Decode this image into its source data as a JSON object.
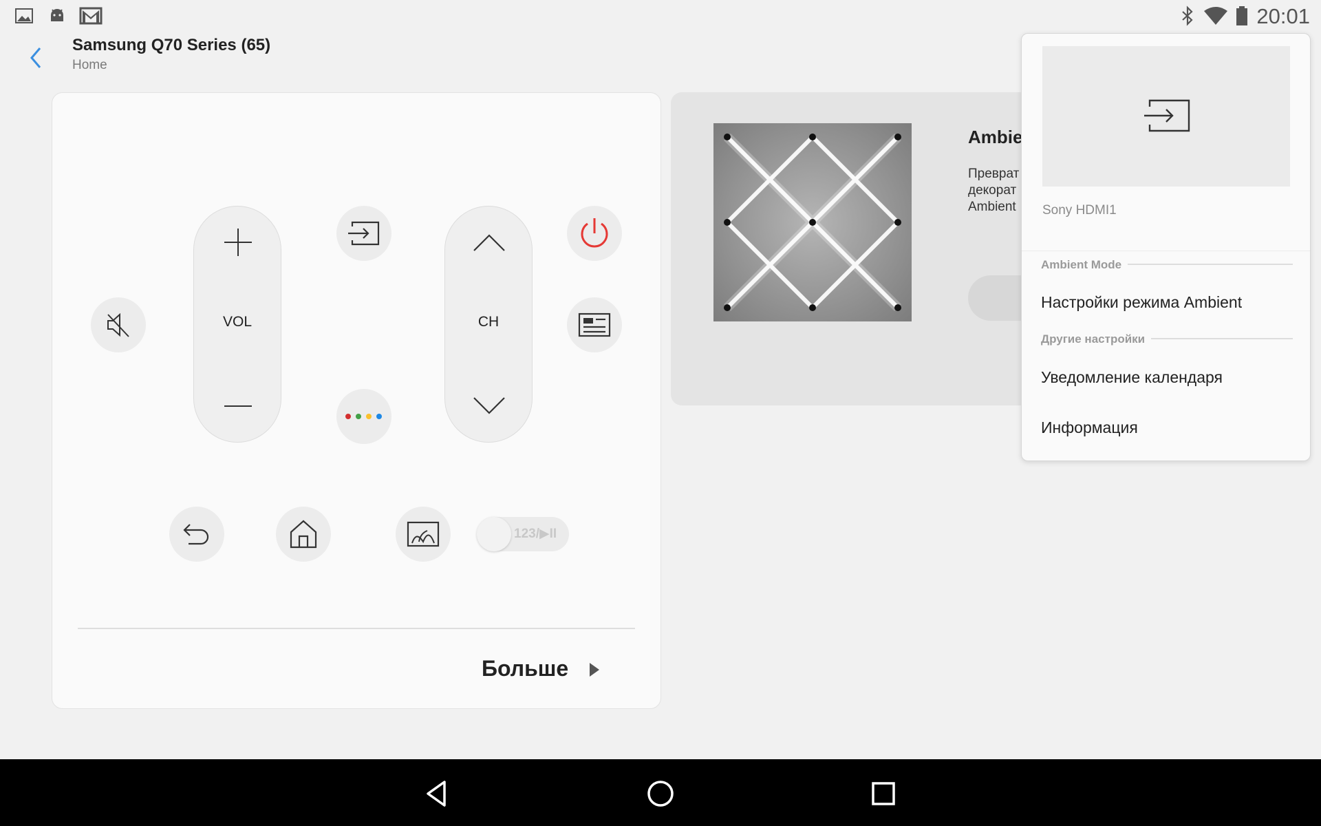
{
  "status_bar": {
    "time": "20:01",
    "icons": [
      "gallery-icon",
      "android-icon",
      "gmail-icon",
      "bluetooth-icon",
      "wifi-icon",
      "battery-icon"
    ]
  },
  "header": {
    "title": "Samsung Q70 Series (65)",
    "subtitle": "Home"
  },
  "remote": {
    "vol_label": "VOL",
    "ch_label": "CH",
    "toggle_label": "123/▶II",
    "more_label": "Больше",
    "colors": {
      "power": "#e53935",
      "dot_red": "#d32f2f",
      "dot_green": "#43a047",
      "dot_yellow": "#fbc02d",
      "dot_blue": "#1e88e5"
    }
  },
  "ambient": {
    "title": "Ambie",
    "desc_line1": "Преврат",
    "desc_line2": "декорат",
    "desc_line3": "Ambient"
  },
  "popup": {
    "source_name": "Sony HDMI1",
    "section1": "Ambient Mode",
    "item1": "Настройки режима Ambient",
    "section2": "Другие настройки",
    "item2": "Уведомление календаря",
    "item3": "Информация"
  },
  "accent_color": "#3b8fe0"
}
